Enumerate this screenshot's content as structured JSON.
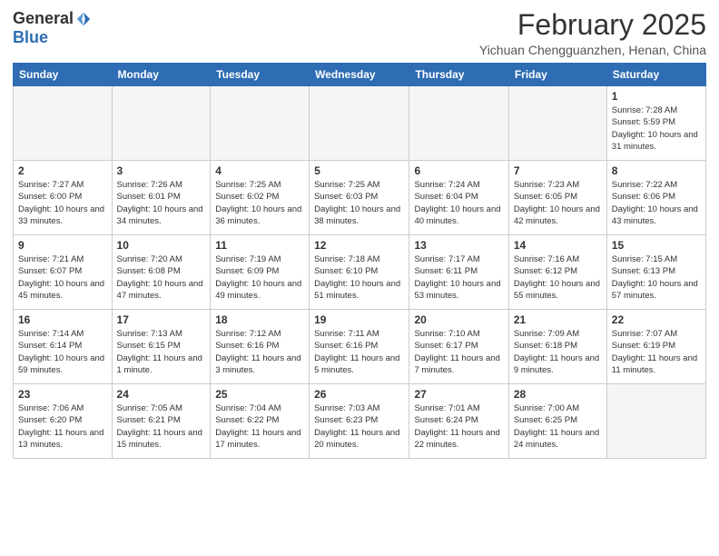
{
  "header": {
    "logo_general": "General",
    "logo_blue": "Blue",
    "month_title": "February 2025",
    "location": "Yichuan Chengguanzhen, Henan, China"
  },
  "weekdays": [
    "Sunday",
    "Monday",
    "Tuesday",
    "Wednesday",
    "Thursday",
    "Friday",
    "Saturday"
  ],
  "weeks": [
    [
      {
        "day": "",
        "info": ""
      },
      {
        "day": "",
        "info": ""
      },
      {
        "day": "",
        "info": ""
      },
      {
        "day": "",
        "info": ""
      },
      {
        "day": "",
        "info": ""
      },
      {
        "day": "",
        "info": ""
      },
      {
        "day": "1",
        "info": "Sunrise: 7:28 AM\nSunset: 5:59 PM\nDaylight: 10 hours and 31 minutes."
      }
    ],
    [
      {
        "day": "2",
        "info": "Sunrise: 7:27 AM\nSunset: 6:00 PM\nDaylight: 10 hours and 33 minutes."
      },
      {
        "day": "3",
        "info": "Sunrise: 7:26 AM\nSunset: 6:01 PM\nDaylight: 10 hours and 34 minutes."
      },
      {
        "day": "4",
        "info": "Sunrise: 7:25 AM\nSunset: 6:02 PM\nDaylight: 10 hours and 36 minutes."
      },
      {
        "day": "5",
        "info": "Sunrise: 7:25 AM\nSunset: 6:03 PM\nDaylight: 10 hours and 38 minutes."
      },
      {
        "day": "6",
        "info": "Sunrise: 7:24 AM\nSunset: 6:04 PM\nDaylight: 10 hours and 40 minutes."
      },
      {
        "day": "7",
        "info": "Sunrise: 7:23 AM\nSunset: 6:05 PM\nDaylight: 10 hours and 42 minutes."
      },
      {
        "day": "8",
        "info": "Sunrise: 7:22 AM\nSunset: 6:06 PM\nDaylight: 10 hours and 43 minutes."
      }
    ],
    [
      {
        "day": "9",
        "info": "Sunrise: 7:21 AM\nSunset: 6:07 PM\nDaylight: 10 hours and 45 minutes."
      },
      {
        "day": "10",
        "info": "Sunrise: 7:20 AM\nSunset: 6:08 PM\nDaylight: 10 hours and 47 minutes."
      },
      {
        "day": "11",
        "info": "Sunrise: 7:19 AM\nSunset: 6:09 PM\nDaylight: 10 hours and 49 minutes."
      },
      {
        "day": "12",
        "info": "Sunrise: 7:18 AM\nSunset: 6:10 PM\nDaylight: 10 hours and 51 minutes."
      },
      {
        "day": "13",
        "info": "Sunrise: 7:17 AM\nSunset: 6:11 PM\nDaylight: 10 hours and 53 minutes."
      },
      {
        "day": "14",
        "info": "Sunrise: 7:16 AM\nSunset: 6:12 PM\nDaylight: 10 hours and 55 minutes."
      },
      {
        "day": "15",
        "info": "Sunrise: 7:15 AM\nSunset: 6:13 PM\nDaylight: 10 hours and 57 minutes."
      }
    ],
    [
      {
        "day": "16",
        "info": "Sunrise: 7:14 AM\nSunset: 6:14 PM\nDaylight: 10 hours and 59 minutes."
      },
      {
        "day": "17",
        "info": "Sunrise: 7:13 AM\nSunset: 6:15 PM\nDaylight: 11 hours and 1 minute."
      },
      {
        "day": "18",
        "info": "Sunrise: 7:12 AM\nSunset: 6:16 PM\nDaylight: 11 hours and 3 minutes."
      },
      {
        "day": "19",
        "info": "Sunrise: 7:11 AM\nSunset: 6:16 PM\nDaylight: 11 hours and 5 minutes."
      },
      {
        "day": "20",
        "info": "Sunrise: 7:10 AM\nSunset: 6:17 PM\nDaylight: 11 hours and 7 minutes."
      },
      {
        "day": "21",
        "info": "Sunrise: 7:09 AM\nSunset: 6:18 PM\nDaylight: 11 hours and 9 minutes."
      },
      {
        "day": "22",
        "info": "Sunrise: 7:07 AM\nSunset: 6:19 PM\nDaylight: 11 hours and 11 minutes."
      }
    ],
    [
      {
        "day": "23",
        "info": "Sunrise: 7:06 AM\nSunset: 6:20 PM\nDaylight: 11 hours and 13 minutes."
      },
      {
        "day": "24",
        "info": "Sunrise: 7:05 AM\nSunset: 6:21 PM\nDaylight: 11 hours and 15 minutes."
      },
      {
        "day": "25",
        "info": "Sunrise: 7:04 AM\nSunset: 6:22 PM\nDaylight: 11 hours and 17 minutes."
      },
      {
        "day": "26",
        "info": "Sunrise: 7:03 AM\nSunset: 6:23 PM\nDaylight: 11 hours and 20 minutes."
      },
      {
        "day": "27",
        "info": "Sunrise: 7:01 AM\nSunset: 6:24 PM\nDaylight: 11 hours and 22 minutes."
      },
      {
        "day": "28",
        "info": "Sunrise: 7:00 AM\nSunset: 6:25 PM\nDaylight: 11 hours and 24 minutes."
      },
      {
        "day": "",
        "info": ""
      }
    ]
  ]
}
